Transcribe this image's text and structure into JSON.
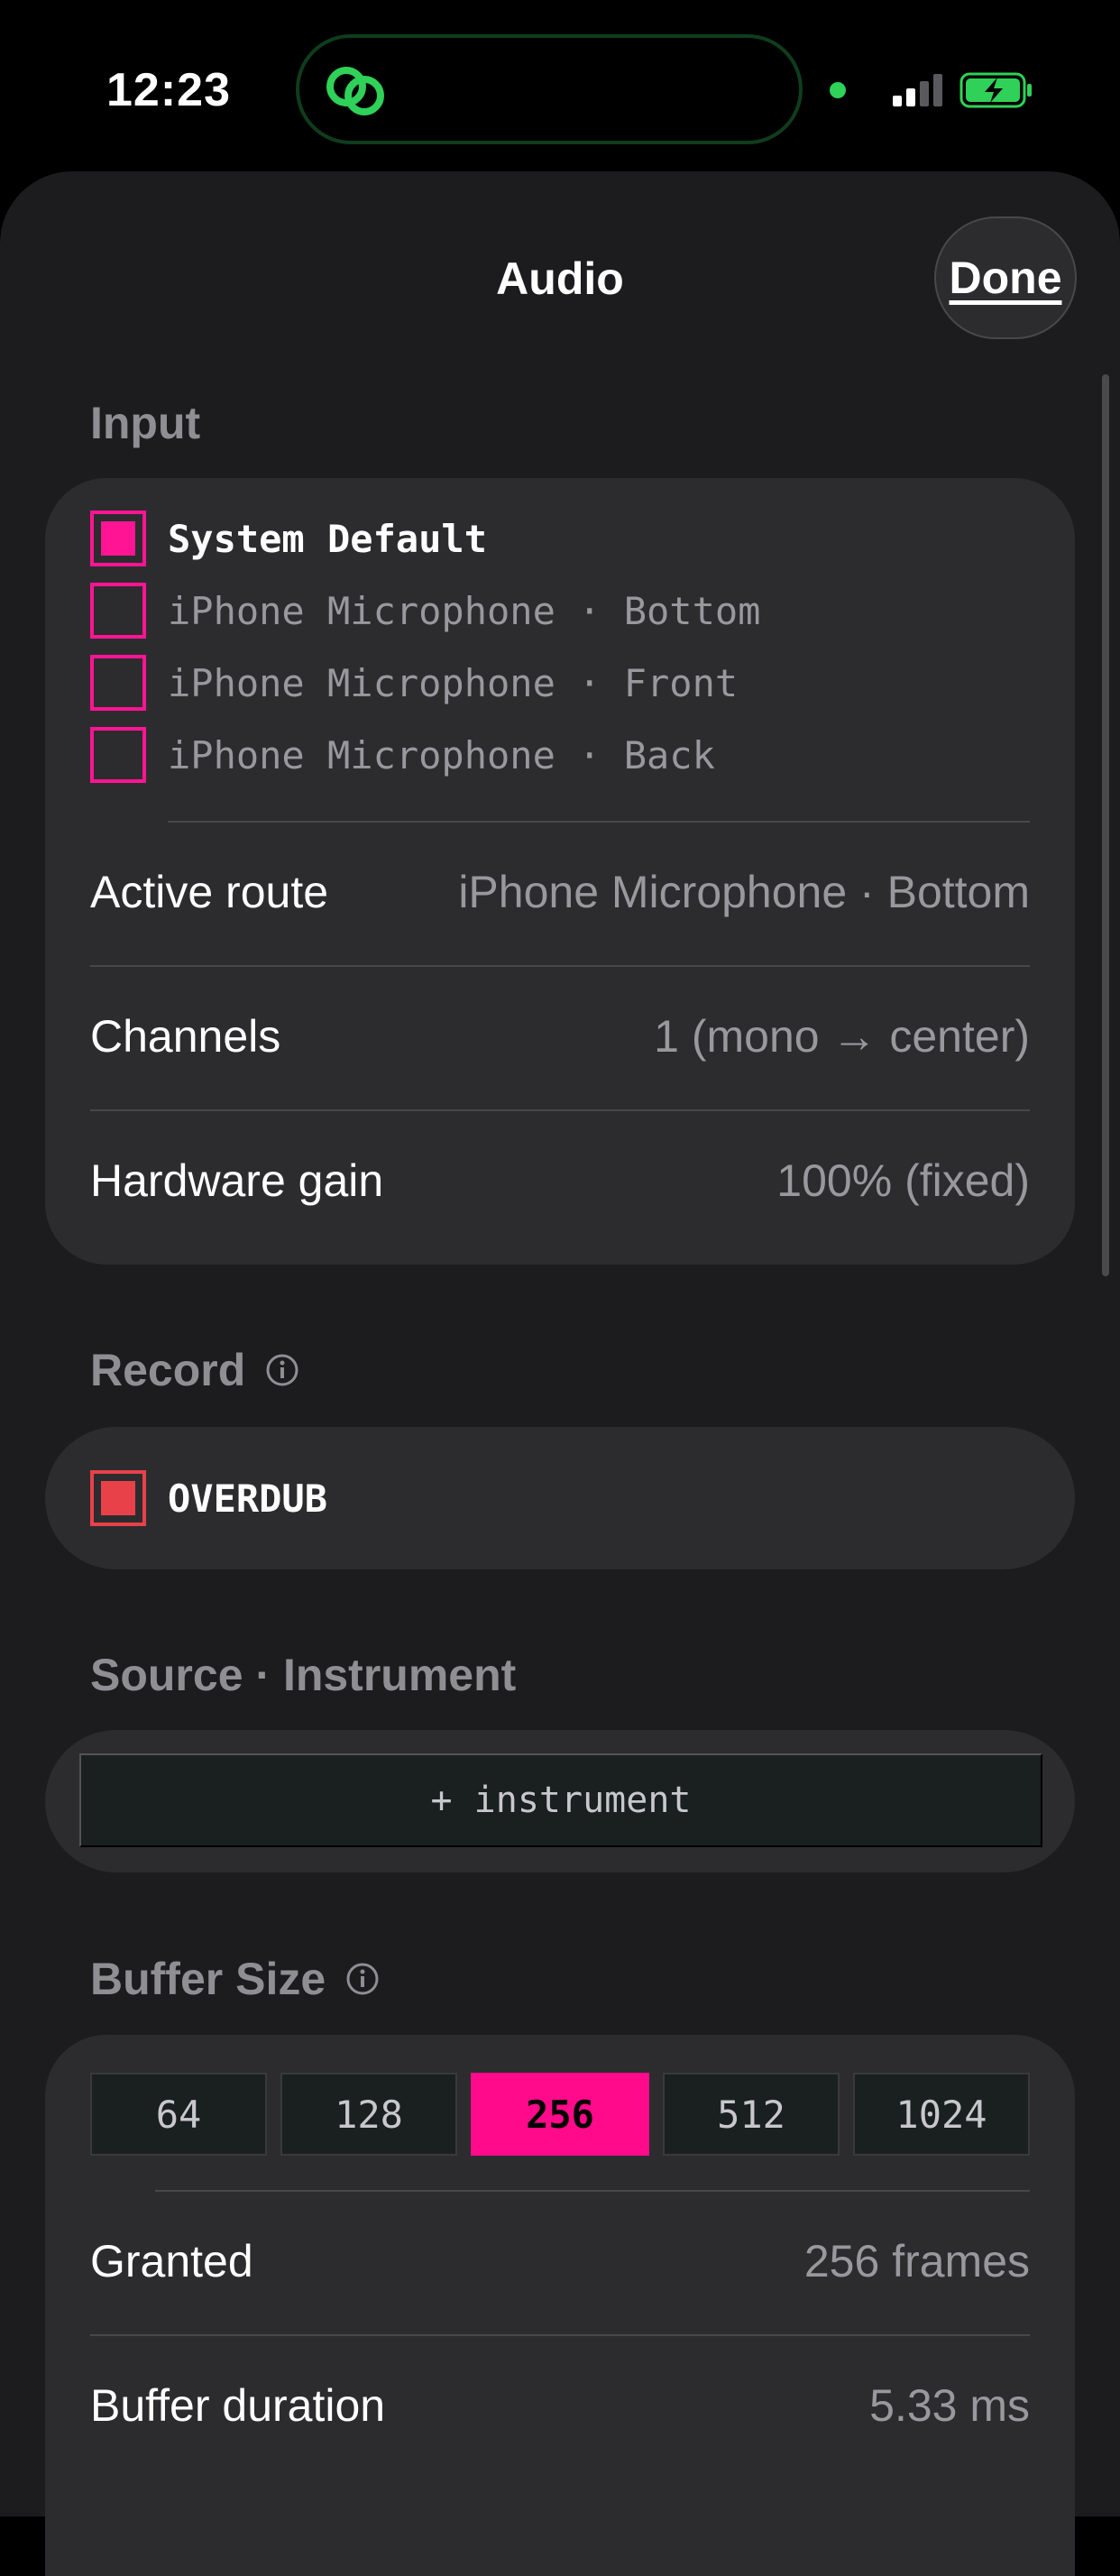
{
  "status_bar": {
    "time": "12:23"
  },
  "header": {
    "title": "Audio",
    "done_label": "Done"
  },
  "input": {
    "section_label": "Input",
    "options": [
      {
        "label": "System Default",
        "selected": true
      },
      {
        "label": "iPhone Microphone · Bottom",
        "selected": false
      },
      {
        "label": "iPhone Microphone · Front",
        "selected": false
      },
      {
        "label": "iPhone Microphone · Back",
        "selected": false
      }
    ],
    "rows": [
      {
        "key": "Active route",
        "value": "iPhone Microphone · Bottom"
      },
      {
        "key": "Channels",
        "value": "1 (mono → center)"
      },
      {
        "key": "Hardware gain",
        "value": "100% (fixed)"
      }
    ]
  },
  "record": {
    "section_label": "Record",
    "overdub_label": "OVERDUB",
    "overdub_checked": true
  },
  "source": {
    "section_label": "Source · Instrument",
    "add_instrument_label": "+ instrument"
  },
  "buffer": {
    "section_label": "Buffer Size",
    "options": [
      "64",
      "128",
      "256",
      "512",
      "1024"
    ],
    "selected": "256",
    "rows": [
      {
        "key": "Granted",
        "value": "256 frames"
      },
      {
        "key": "Buffer duration",
        "value": "5.33 ms"
      }
    ]
  },
  "colors": {
    "accent": "#ff0a8a",
    "record": "#e8414a",
    "sheet": "#1c1c1e",
    "card": "#2c2c2e"
  }
}
